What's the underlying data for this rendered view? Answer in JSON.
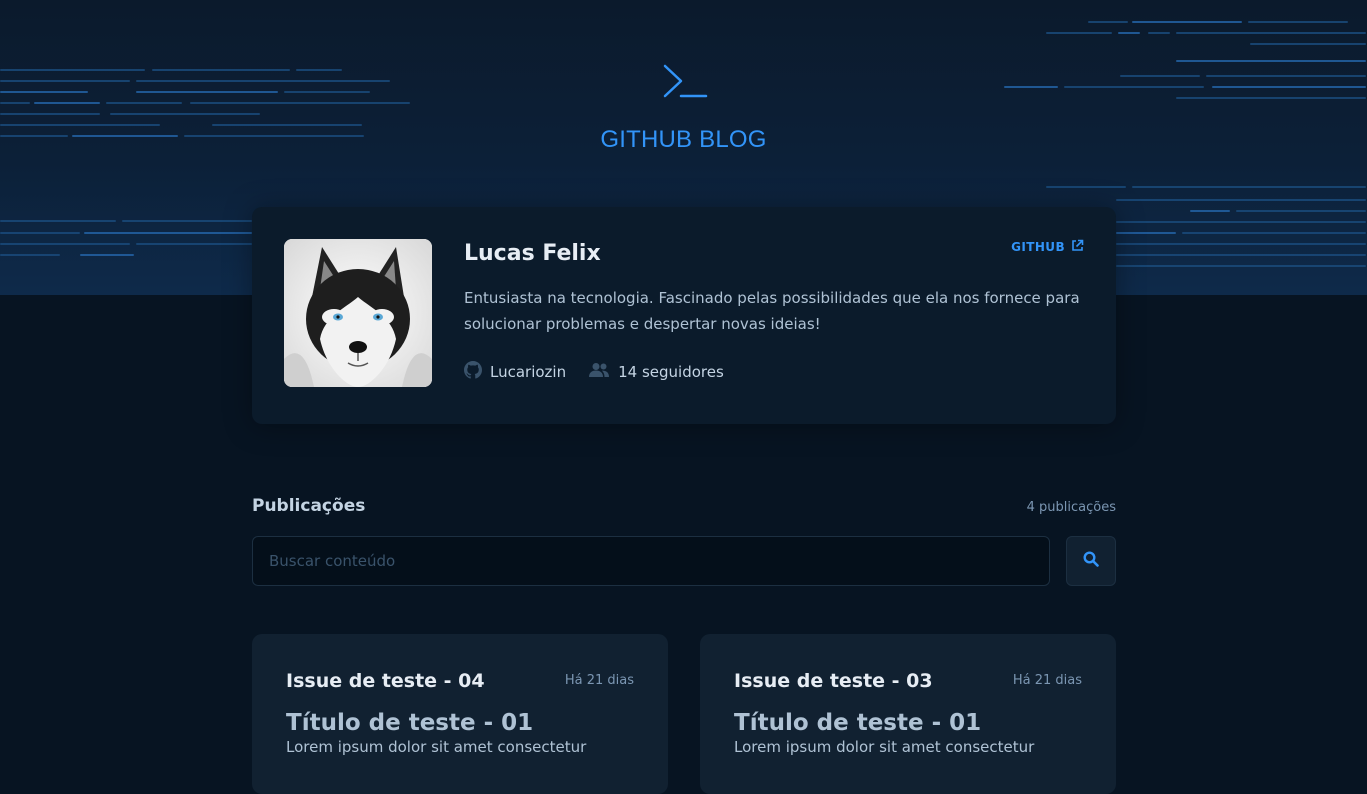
{
  "header": {
    "title": "GITHUB BLOG",
    "logo_icon": "terminal-prompt-icon"
  },
  "profile": {
    "name": "Lucas Felix",
    "github_label": "GITHUB",
    "bio": "Entusiasta na tecnologia. Fascinado pelas possibilidades que ela nos fornece para solucionar problemas e despertar novas ideias!",
    "username": "Lucariozin",
    "followers": "14 seguidores",
    "avatar": "husky-dog-photo"
  },
  "publications": {
    "title": "Publicações",
    "count": "4 publicações",
    "search_placeholder": "Buscar conteúdo"
  },
  "posts": [
    {
      "issue": "Issue de teste - 04",
      "date": "Há 21 dias",
      "title": "Título de teste - 01",
      "body": "Lorem ipsum dolor sit amet consectetur"
    },
    {
      "issue": "Issue de teste - 03",
      "date": "Há 21 dias",
      "title": "Título de teste - 01",
      "body": "Lorem ipsum dolor sit amet consectetur"
    }
  ],
  "colors": {
    "accent": "#3294f8",
    "background": "#071422",
    "card": "#0b1b2b"
  }
}
